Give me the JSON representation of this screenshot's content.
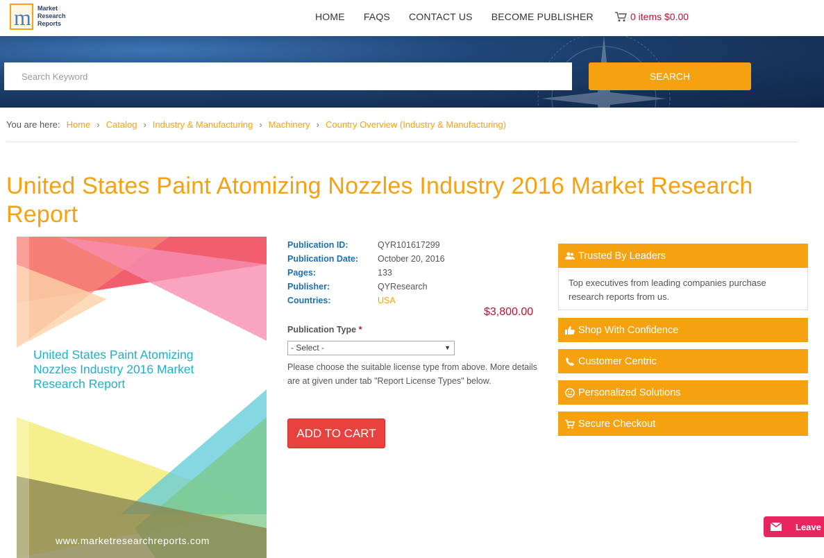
{
  "header": {
    "logo_text_line1": "Market",
    "logo_text_line2": "Research",
    "logo_text_line3": "Reports",
    "nav": [
      "HOME",
      "FAQS",
      "CONTACT US",
      "BECOME PUBLISHER"
    ],
    "cart_label": "0 items $0.00"
  },
  "search": {
    "placeholder": "Search Keyword",
    "button_label": "SEARCH"
  },
  "breadcrumb": {
    "label": "You are here:",
    "items": [
      "Home",
      "Catalog",
      "Industry & Manufacturing",
      "Machinery",
      "Country Overview (Industry & Manufacturing)"
    ]
  },
  "product": {
    "title": "United States Paint Atomizing Nozzles Industry 2016 Market Research Report",
    "cover_title": "United States Paint Atomizing Nozzles Industry 2016 Market Research Report",
    "cover_url": "www.marketresearchreports.com",
    "meta": [
      {
        "key": "Publication ID:",
        "value": "QYR101617299"
      },
      {
        "key": "Publication Date:",
        "value": "October 20, 2016"
      },
      {
        "key": "Pages:",
        "value": "133"
      },
      {
        "key": "Publisher:",
        "value": "QYResearch"
      },
      {
        "key": "Countries:",
        "value": "USA"
      }
    ],
    "price": "$3,800.00",
    "pub_type_label": "Publication Type",
    "pub_type_required": "*",
    "select_value": "- Select -",
    "note": "Please choose the suitable license type from above. More details are at given under tab \"Report License Types\" below.",
    "add_to_cart": "ADD TO CART"
  },
  "sidebar": {
    "panels": [
      {
        "label": "Trusted By Leaders",
        "icon": "users-icon"
      },
      {
        "label": "Shop With Confidence",
        "icon": "thumbs-up-icon"
      },
      {
        "label": "Customer Centric",
        "icon": "phone-icon"
      },
      {
        "label": "Personalized Solutions",
        "icon": "smile-icon"
      },
      {
        "label": "Secure Checkout",
        "icon": "cart-icon"
      }
    ],
    "trusted_body": "Top executives from leading companies purchase research reports from us."
  },
  "leave_message": "Leave",
  "colors": {
    "accent": "#f6a10f",
    "price": "#c0112e",
    "cart_button": "#e8413e",
    "meta_key": "#1a6fb5"
  }
}
